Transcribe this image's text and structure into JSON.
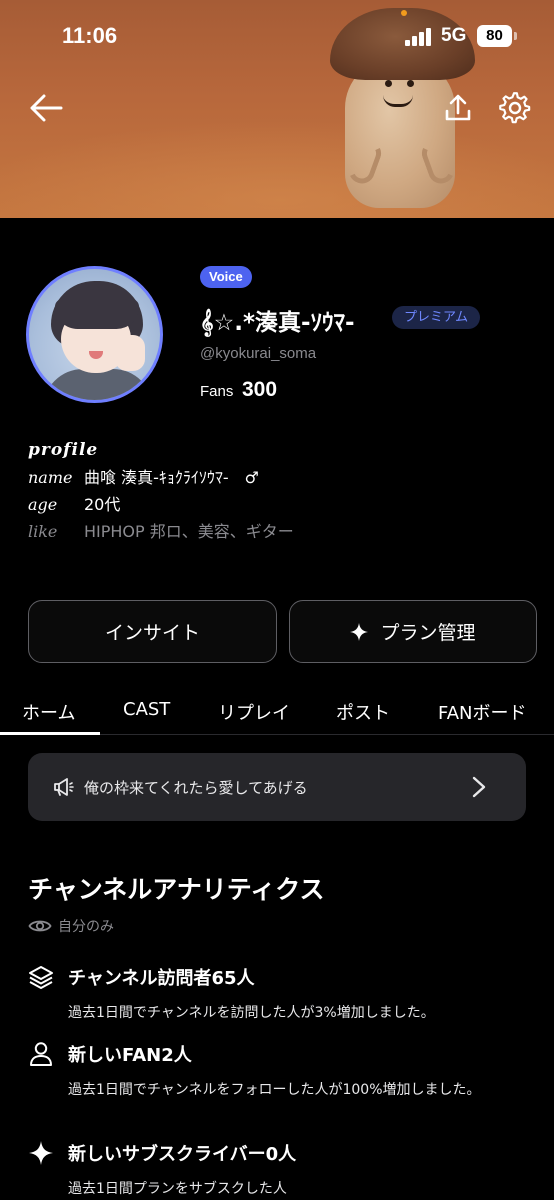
{
  "status_bar": {
    "time": "11:06",
    "network": "5G",
    "battery": "80"
  },
  "profile": {
    "badge": "Voice",
    "display_name": "𝄞☆.*湊真-ｿｳﾏ-",
    "premium_label": "プレミアム",
    "handle": "@kyokurai_soma",
    "fans_label": "Fans",
    "fans_count": "300"
  },
  "bio": {
    "title": "profile",
    "rows": [
      {
        "key": "name",
        "value": "曲喰 湊真-ｷｮｸﾗｲｿｳﾏ-　♂"
      },
      {
        "key": "age",
        "value": "20代"
      },
      {
        "key": "like",
        "value": "HIPHOP 邦ロ、美容、ギター"
      }
    ]
  },
  "buttons": {
    "insight": "インサイト",
    "plan": "プラン管理"
  },
  "tabs": [
    "ホーム",
    "CAST",
    "リプレイ",
    "ポスト",
    "FANボード"
  ],
  "notice": {
    "text": "俺の枠来てくれたら愛してあげる"
  },
  "analytics": {
    "title": "チャンネルアナリティクス",
    "visibility": "自分のみ",
    "items": [
      {
        "heading": "チャンネル訪問者65人",
        "description": "過去1日間でチャンネルを訪問した人が3%増加しました。",
        "icon": "layers-icon"
      },
      {
        "heading": "新しいFAN2人",
        "description": "過去1日間でチャンネルをフォローした人が100%増加しました。",
        "icon": "person-icon"
      },
      {
        "heading": "新しいサブスクライバー0人",
        "description": "過去1日間プランをサブスクした人",
        "icon": "sparkle-icon"
      }
    ]
  },
  "colors": {
    "accent": "#4d63f0",
    "premium_text": "#6f88ff",
    "muted": "#8a8a8f",
    "background": "#000000"
  }
}
